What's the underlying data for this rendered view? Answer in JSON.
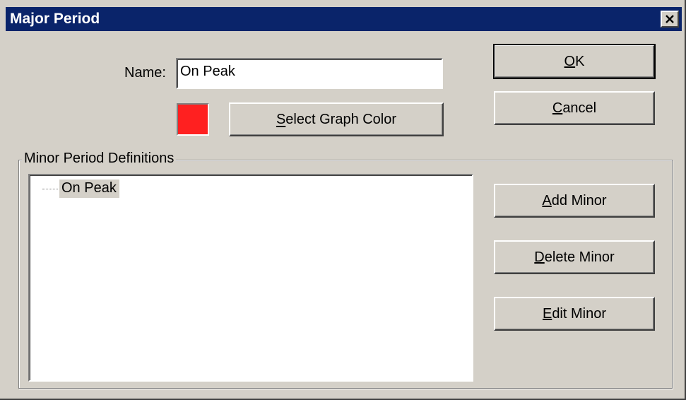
{
  "window": {
    "title": "Major Period",
    "close_glyph": "✕"
  },
  "form": {
    "name_label": "Name:",
    "name_value": "On Peak",
    "graph_color": "#ff2020",
    "select_color_label": "Select Graph Color"
  },
  "buttons": {
    "ok": "OK",
    "cancel": "Cancel",
    "add_minor": "Add Minor",
    "delete_minor": "Delete Minor",
    "edit_minor": "Edit Minor"
  },
  "minor_group": {
    "label": "Minor Period Definitions",
    "items": [
      {
        "label": "On Peak",
        "selected": true
      }
    ]
  },
  "colors": {
    "title_bar": "#0a246a",
    "face": "#d4d0c8"
  }
}
